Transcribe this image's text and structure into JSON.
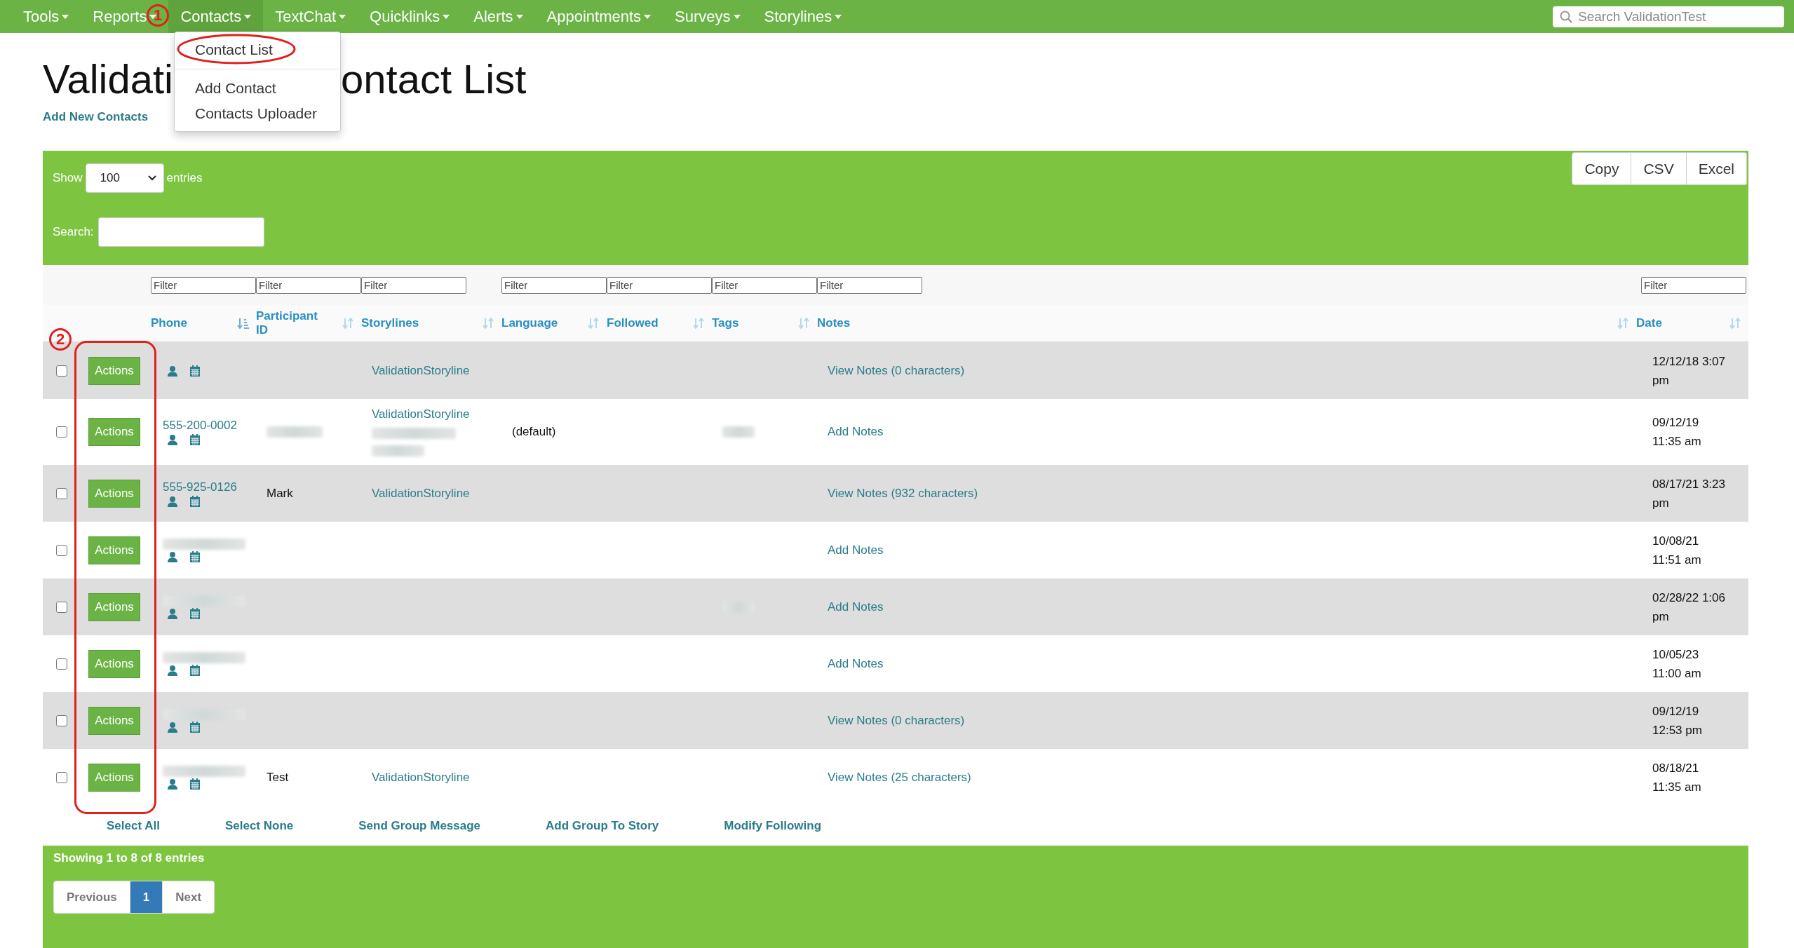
{
  "nav": {
    "items": [
      {
        "label": "Tools",
        "open": false
      },
      {
        "label": "Reports",
        "open": false
      },
      {
        "label": "Contacts",
        "open": true,
        "dropdown": [
          {
            "kind": "item",
            "label": "Contact List"
          },
          {
            "kind": "divider"
          },
          {
            "kind": "item",
            "label": "Add Contact"
          },
          {
            "kind": "item",
            "label": "Contacts Uploader"
          }
        ]
      },
      {
        "label": "TextChat",
        "open": false
      },
      {
        "label": "Quicklinks",
        "open": false
      },
      {
        "label": "Alerts",
        "open": false
      },
      {
        "label": "Appointments",
        "open": false
      },
      {
        "label": "Surveys",
        "open": false
      },
      {
        "label": "Storylines",
        "open": false
      }
    ],
    "search": {
      "placeholder": "Search ValidationTest"
    }
  },
  "page": {
    "title_parts": [
      "Validati",
      "ontact List"
    ],
    "add_link": "Add New Contacts"
  },
  "panel": {
    "show_label": "Show",
    "page_size": "100",
    "entries_label": "entries",
    "search_label": "Search:",
    "export_buttons": [
      "Copy",
      "CSV",
      "Excel"
    ]
  },
  "table": {
    "columns": [
      {
        "label": "Phone",
        "sorted": true,
        "filter": {
          "placeholder": "Filter"
        }
      },
      {
        "label": "Participant ID",
        "sorted": false,
        "filter": {
          "placeholder": "Filter"
        }
      },
      {
        "label": "Storylines",
        "sorted": false,
        "filter": {
          "placeholder": "Filter"
        }
      },
      {
        "label": "Language",
        "sorted": false,
        "filter": {
          "placeholder": "Filter"
        }
      },
      {
        "label": "Followed",
        "sorted": false,
        "filter": {
          "placeholder": "Filter"
        }
      },
      {
        "label": "Tags",
        "sorted": false,
        "filter": {
          "placeholder": "Filter"
        }
      },
      {
        "label": "Notes",
        "sorted": false,
        "filter": {
          "placeholder": "Filter"
        }
      },
      {
        "label": "Date",
        "sorted": false,
        "filter": {
          "placeholder": "Filter"
        }
      }
    ],
    "rows": [
      {
        "checked": false,
        "action_label": "Actions",
        "storylines": [
          "ValidationStoryline"
        ],
        "notes": "View Notes (0 characters)",
        "date": [
          "12/12/18 3:07",
          "pm"
        ]
      },
      {
        "checked": false,
        "action_label": "Actions",
        "phone": "555-200-0002",
        "pid_redacted": true,
        "storylines": [
          "ValidationStoryline"
        ],
        "storyline_extra_redacted": true,
        "language": "(default)",
        "tags_redacted": true,
        "notes": "Add Notes",
        "date": [
          "09/12/19",
          "11:35 am"
        ]
      },
      {
        "checked": false,
        "action_label": "Actions",
        "phone": "555-925-0126",
        "pid": "Mark",
        "storylines": [
          "ValidationStoryline"
        ],
        "notes": "View Notes (932 characters)",
        "date": [
          "08/17/21 3:23",
          "pm"
        ]
      },
      {
        "checked": false,
        "action_label": "Actions",
        "phone_redacted": true,
        "notes": "Add Notes",
        "date": [
          "10/08/21",
          "11:51 am"
        ]
      },
      {
        "checked": false,
        "action_label": "Actions",
        "phone_redacted": true,
        "tags_redacted": true,
        "notes": "Add Notes",
        "date": [
          "02/28/22 1:06",
          "pm"
        ]
      },
      {
        "checked": false,
        "action_label": "Actions",
        "phone_redacted": true,
        "notes": "Add Notes",
        "date": [
          "10/05/23",
          "11:00 am"
        ]
      },
      {
        "checked": false,
        "action_label": "Actions",
        "phone_redacted": true,
        "notes": "View Notes (0 characters)",
        "date": [
          "09/12/19",
          "12:53 pm"
        ]
      },
      {
        "checked": false,
        "action_label": "Actions",
        "phone_redacted": true,
        "pid": "Test",
        "storylines": [
          "ValidationStoryline"
        ],
        "notes": "View Notes (25 characters)",
        "date": [
          "08/18/21",
          "11:35 am"
        ]
      }
    ]
  },
  "bulk_actions": [
    "Select All",
    "Select None",
    "Send Group Message",
    "Add Group To Story",
    "Modify Following"
  ],
  "footer": {
    "info": "Showing 1 to 8 of 8 entries",
    "pagination": [
      {
        "label": "Previous",
        "selected": false
      },
      {
        "label": "1",
        "selected": true
      },
      {
        "label": "Next",
        "selected": false
      }
    ]
  },
  "annotations": [
    {
      "label": "1"
    },
    {
      "label": "2"
    }
  ]
}
